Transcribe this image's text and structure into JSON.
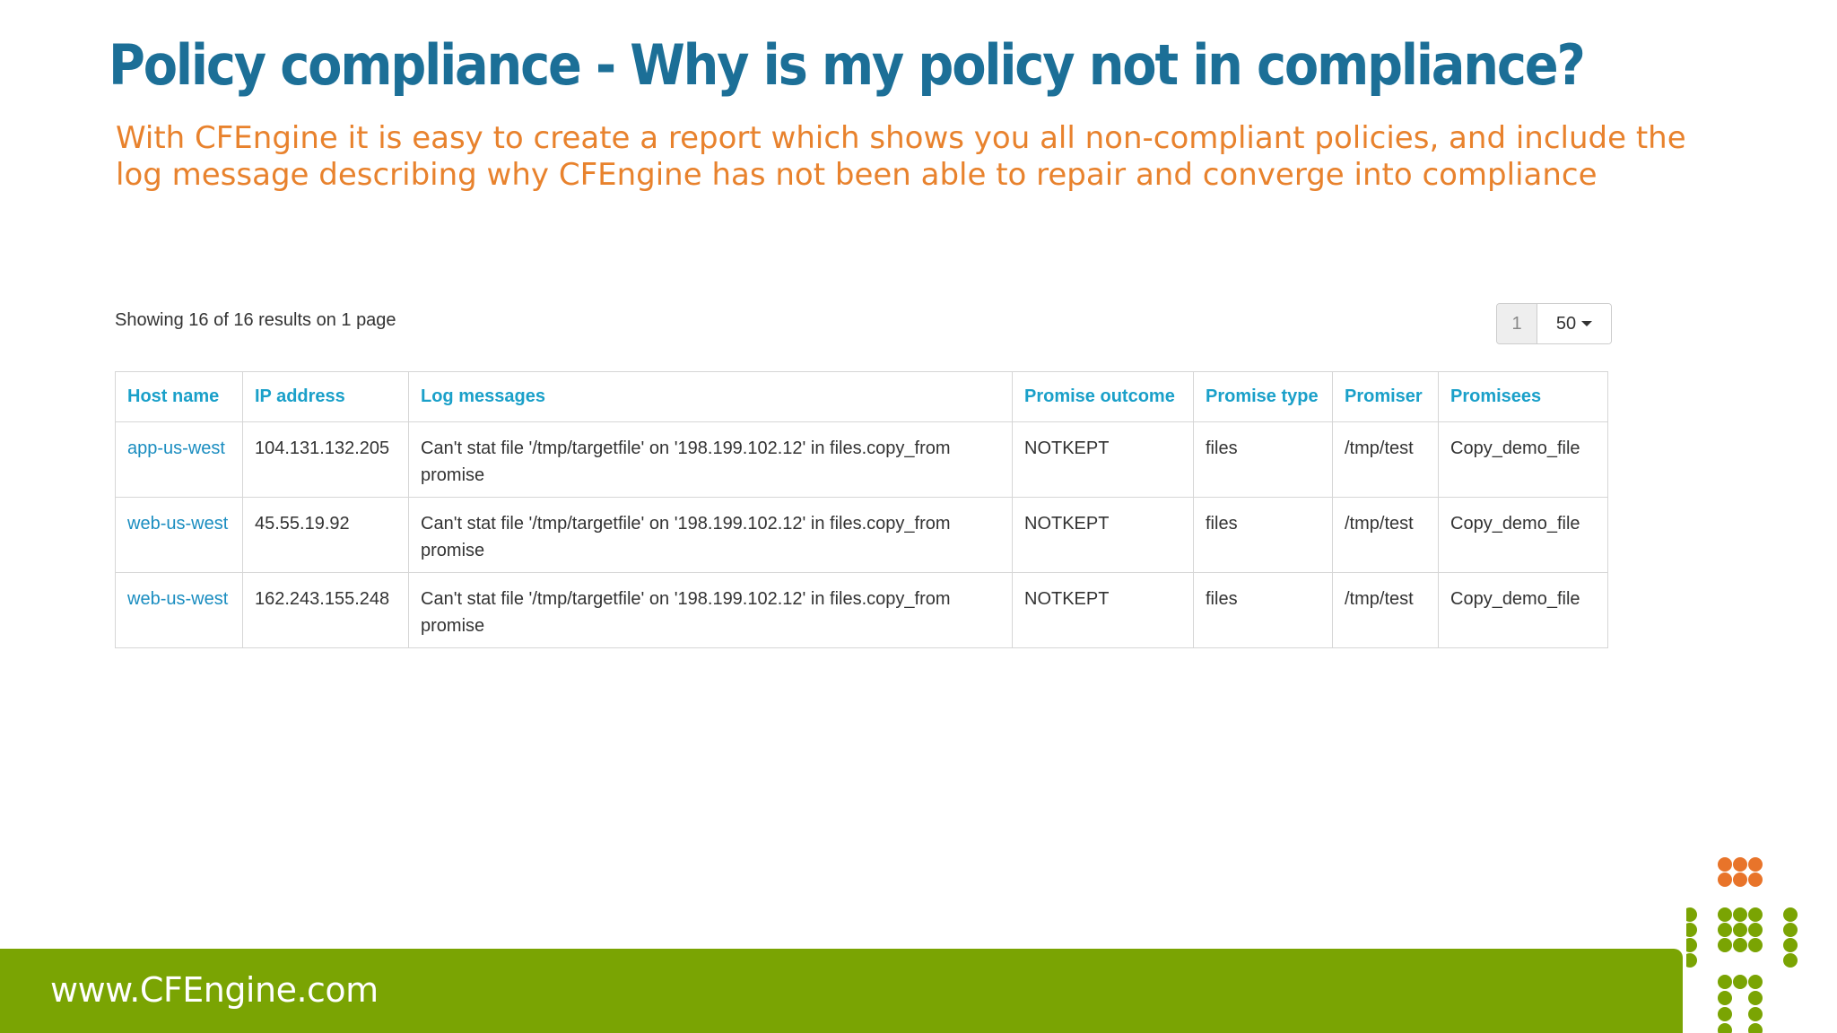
{
  "slide": {
    "title": "Policy compliance - Why is my policy not in compliance?",
    "subtitle": "With CFEngine it is easy to create a report which shows you all non-compliant policies, and include the log message describing why CFEngine has not been able to repair and converge into compliance",
    "footer_url": "www.CFEngine.com"
  },
  "report": {
    "results_text": "Showing 16 of 16 results on 1 page",
    "pagination": {
      "current_page": "1",
      "per_page": "50"
    },
    "columns": [
      "Host name",
      "IP address",
      "Log messages",
      "Promise outcome",
      "Promise type",
      "Promiser",
      "Promisees"
    ],
    "rows": [
      {
        "host": "app-us-west",
        "ip": "104.131.132.205",
        "log": "Can't stat file '/tmp/targetfile' on '198.199.102.12' in files.copy_from promise",
        "outcome": "NOTKEPT",
        "type": "files",
        "promiser": "/tmp/test",
        "promisees": "Copy_demo_file"
      },
      {
        "host": "web-us-west",
        "ip": "45.55.19.92",
        "log": "Can't stat file '/tmp/targetfile' on '198.199.102.12' in files.copy_from promise",
        "outcome": "NOTKEPT",
        "type": "files",
        "promiser": "/tmp/test",
        "promisees": "Copy_demo_file"
      },
      {
        "host": "web-us-west",
        "ip": "162.243.155.248",
        "log": "Can't stat file '/tmp/targetfile' on '198.199.102.12' in files.copy_from promise",
        "outcome": "NOTKEPT",
        "type": "files",
        "promiser": "/tmp/test",
        "promisees": "Copy_demo_file"
      }
    ]
  },
  "colors": {
    "title": "#1c6f97",
    "subtitle": "#e8822d",
    "header_link": "#1aa0c9",
    "footer": "#7aa403",
    "logo_orange": "#e8742a",
    "logo_green": "#7aa403"
  }
}
